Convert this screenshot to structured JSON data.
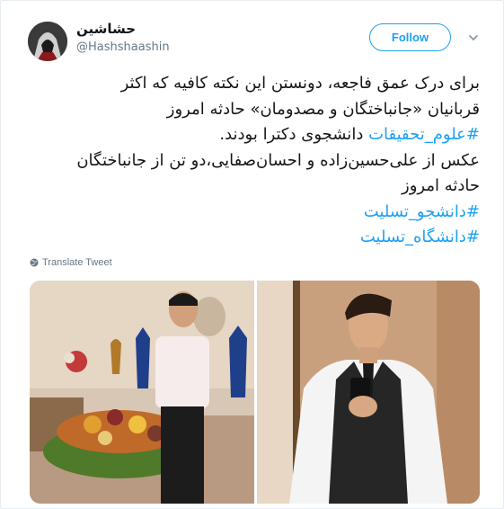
{
  "user": {
    "display_name": "حشاشین",
    "handle": "@Hashshaashin",
    "avatar_icon": "hooded-figure-avatar"
  },
  "follow_button": {
    "label": "Follow"
  },
  "menu": {
    "icon": "chevron-down-icon"
  },
  "tweet": {
    "line1": "برای درک عمق فاجعه، دونستن این نکته کافیه که اکثر",
    "line2": "قربانیان «جانباختگان و مصدومان» حادثه امروز",
    "line3_hashtag": "#علوم_تحقیقات",
    "line3_text": " دانشجوی دکترا بودند.",
    "line4": "عکس از علی‌حسین‌زاده و احسان‌صفایی،دو تن از جانباختگان",
    "line5": "حادثه امروز",
    "hashtag1": "#دانشجو_تسلیت",
    "hashtag2": "#دانشگاه_تسلیت"
  },
  "translate": {
    "label": "Translate Tweet",
    "icon": "globe-icon"
  },
  "colors": {
    "accent": "#1da1f2",
    "text": "#14171a",
    "muted": "#657786"
  }
}
